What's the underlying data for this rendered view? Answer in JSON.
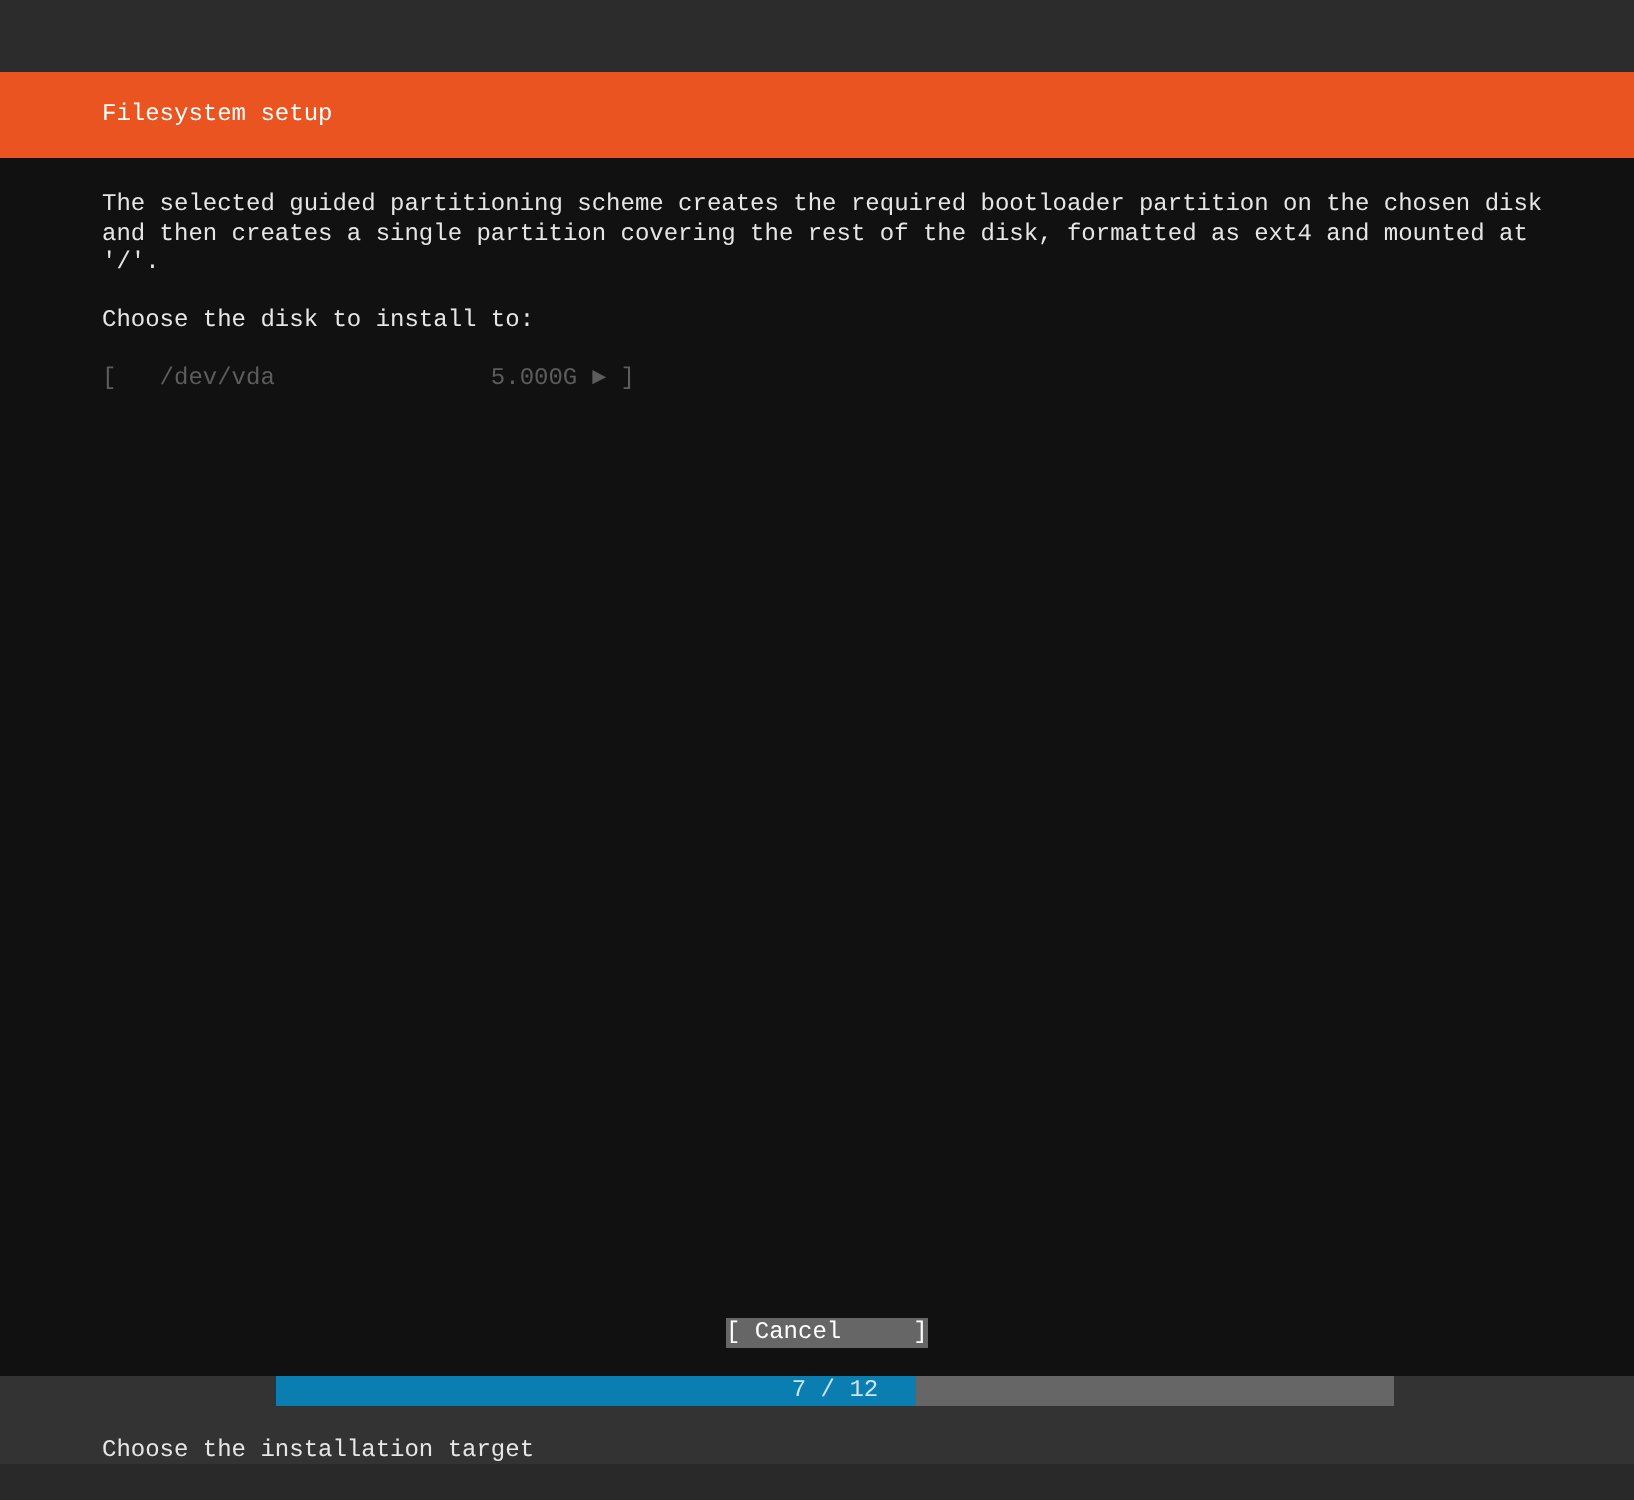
{
  "header": {
    "title": "Filesystem setup"
  },
  "body": {
    "description": "The selected guided partitioning scheme creates the required bootloader partition on the chosen disk and then creates a single partition covering the rest of the disk, formatted as ext4 and mounted at '/'.",
    "prompt": "Choose the disk to install to:",
    "disks": [
      {
        "left_bracket": "[",
        "device": "/dev/vda",
        "size": "5.000G",
        "arrow": "►",
        "right_bracket": "]",
        "disabled": true
      }
    ]
  },
  "buttons": [
    {
      "left_bracket": "[",
      "label": "Cancel",
      "right_bracket": "]",
      "focused": true
    }
  ],
  "progress": {
    "level": 0.573,
    "label": "7 / 12"
  },
  "status_bar": {
    "text": "Choose the installation target"
  }
}
